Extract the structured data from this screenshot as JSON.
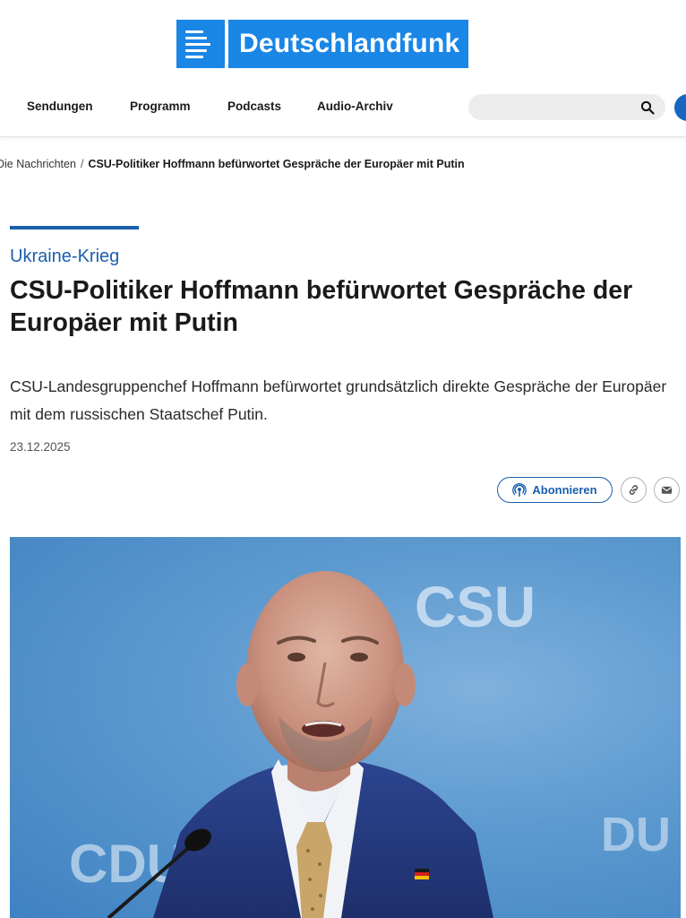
{
  "brand": {
    "name": "Deutschlandfunk",
    "color": "#1a86e6"
  },
  "nav": {
    "items": [
      "Sendungen",
      "Programm",
      "Podcasts",
      "Audio-Archiv"
    ],
    "search_placeholder": ""
  },
  "breadcrumb": {
    "parent": "Die Nachrichten",
    "separator": "/",
    "current": "CSU-Politiker Hoffmann befürwortet Gespräche der Europäer mit Putin"
  },
  "article": {
    "kicker": "Ukraine-Krieg",
    "headline": "CSU-Politiker Hoffmann befürwortet Gespräche der Europäer mit Putin",
    "teaser": "CSU-Landesgruppenchef Hoffmann befürwortet grundsätzlich direkte Gespräche der Europäer mit dem russischen Staatschef Putin.",
    "date": "23.12.2025",
    "accent_color": "#1b5fae"
  },
  "actions": {
    "subscribe_label": "Abonnieren",
    "icons": [
      "podcast-icon",
      "link-icon",
      "mail-icon"
    ]
  },
  "photo": {
    "backdrop_texts": [
      "CSU",
      "CDU",
      "DU"
    ]
  }
}
